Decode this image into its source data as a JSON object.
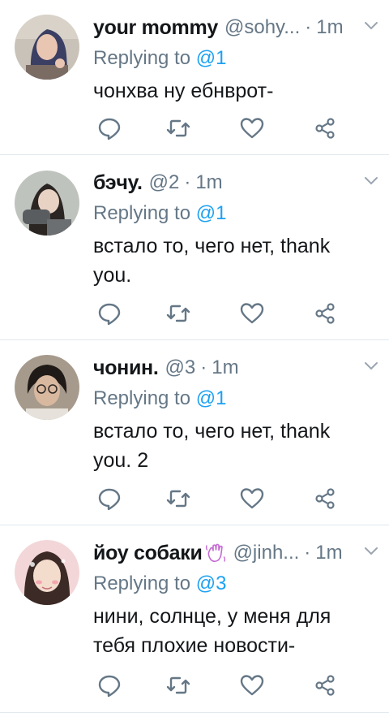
{
  "tweets": [
    {
      "display_name": "your mommy",
      "has_emoji": false,
      "handle": "@sohy...",
      "separator": "·",
      "time": "1m",
      "reply_prefix": "Replying to",
      "reply_target": "@1",
      "text": "чонхва ну ебнврот-",
      "avatar_colors": {
        "bg": "#c9c2b8",
        "hair": "#3a3f63",
        "skin": "#e9c6b2"
      }
    },
    {
      "display_name": "бэчу.",
      "has_emoji": false,
      "handle": "@2",
      "separator": "·",
      "time": "1m",
      "reply_prefix": "Replying to",
      "reply_target": "@1",
      "text": "встало то, чего нет, thank you.",
      "avatar_colors": {
        "bg": "#bfc3bd",
        "hair": "#2a2522",
        "skin": "#e8d2c3"
      }
    },
    {
      "display_name": "чонин.",
      "has_emoji": false,
      "handle": "@3",
      "separator": "·",
      "time": "1m",
      "reply_prefix": "Replying to",
      "reply_target": "@1",
      "text": "встало то, чего нет, thank you. 2",
      "avatar_colors": {
        "bg": "#a69a8c",
        "hair": "#1f1a17",
        "skin": "#d9b8a0"
      }
    },
    {
      "display_name": "йоу собаки",
      "has_emoji": true,
      "handle": "@jinh...",
      "separator": "·",
      "time": "1m",
      "reply_prefix": "Replying to",
      "reply_target": "@3",
      "text": "нини, солнце, у меня для тебя плохие новости-",
      "avatar_colors": {
        "bg": "#f3d6d8",
        "hair": "#3b2a26",
        "skin": "#f4dccd"
      }
    }
  ],
  "icons": {
    "reply": "reply-icon",
    "retweet": "retweet-icon",
    "like": "like-icon",
    "share": "share-icon",
    "caret": "chevron-down-icon",
    "emoji": "waving-hand-emoji"
  },
  "colors": {
    "text": "#14171a",
    "muted": "#657786",
    "link": "#1da1f2",
    "divider": "#e1e8ed"
  }
}
